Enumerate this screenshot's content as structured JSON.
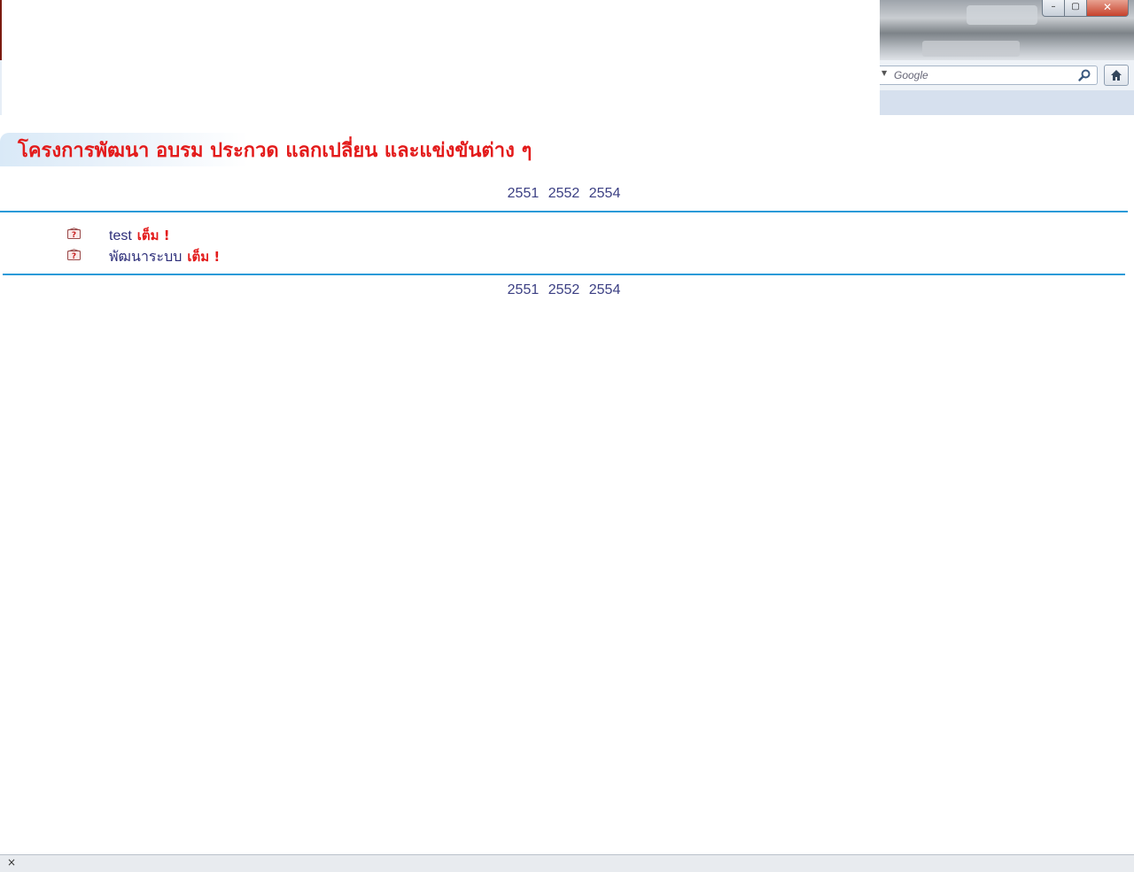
{
  "browser": {
    "search_placeholder": "Google",
    "window_buttons": {
      "minimize": "–",
      "maximize": "▢",
      "close": "✕"
    }
  },
  "page": {
    "title": "โครงการพัฒนา อบรม ประกวด แลกเปลี่ยน และแข่งขันต่าง ๆ",
    "years": [
      "2551",
      "2552",
      "2554"
    ],
    "items": [
      {
        "label": "test",
        "status": "เต็ม !"
      },
      {
        "label": "พัฒนาระบบ",
        "status": "เต็ม !"
      }
    ]
  },
  "status_bar": {
    "close_label": "×"
  },
  "colors": {
    "title": "#e31b1b",
    "link": "#2e2f7a",
    "rule": "#2a9ad8",
    "year": "#3b3f83"
  }
}
